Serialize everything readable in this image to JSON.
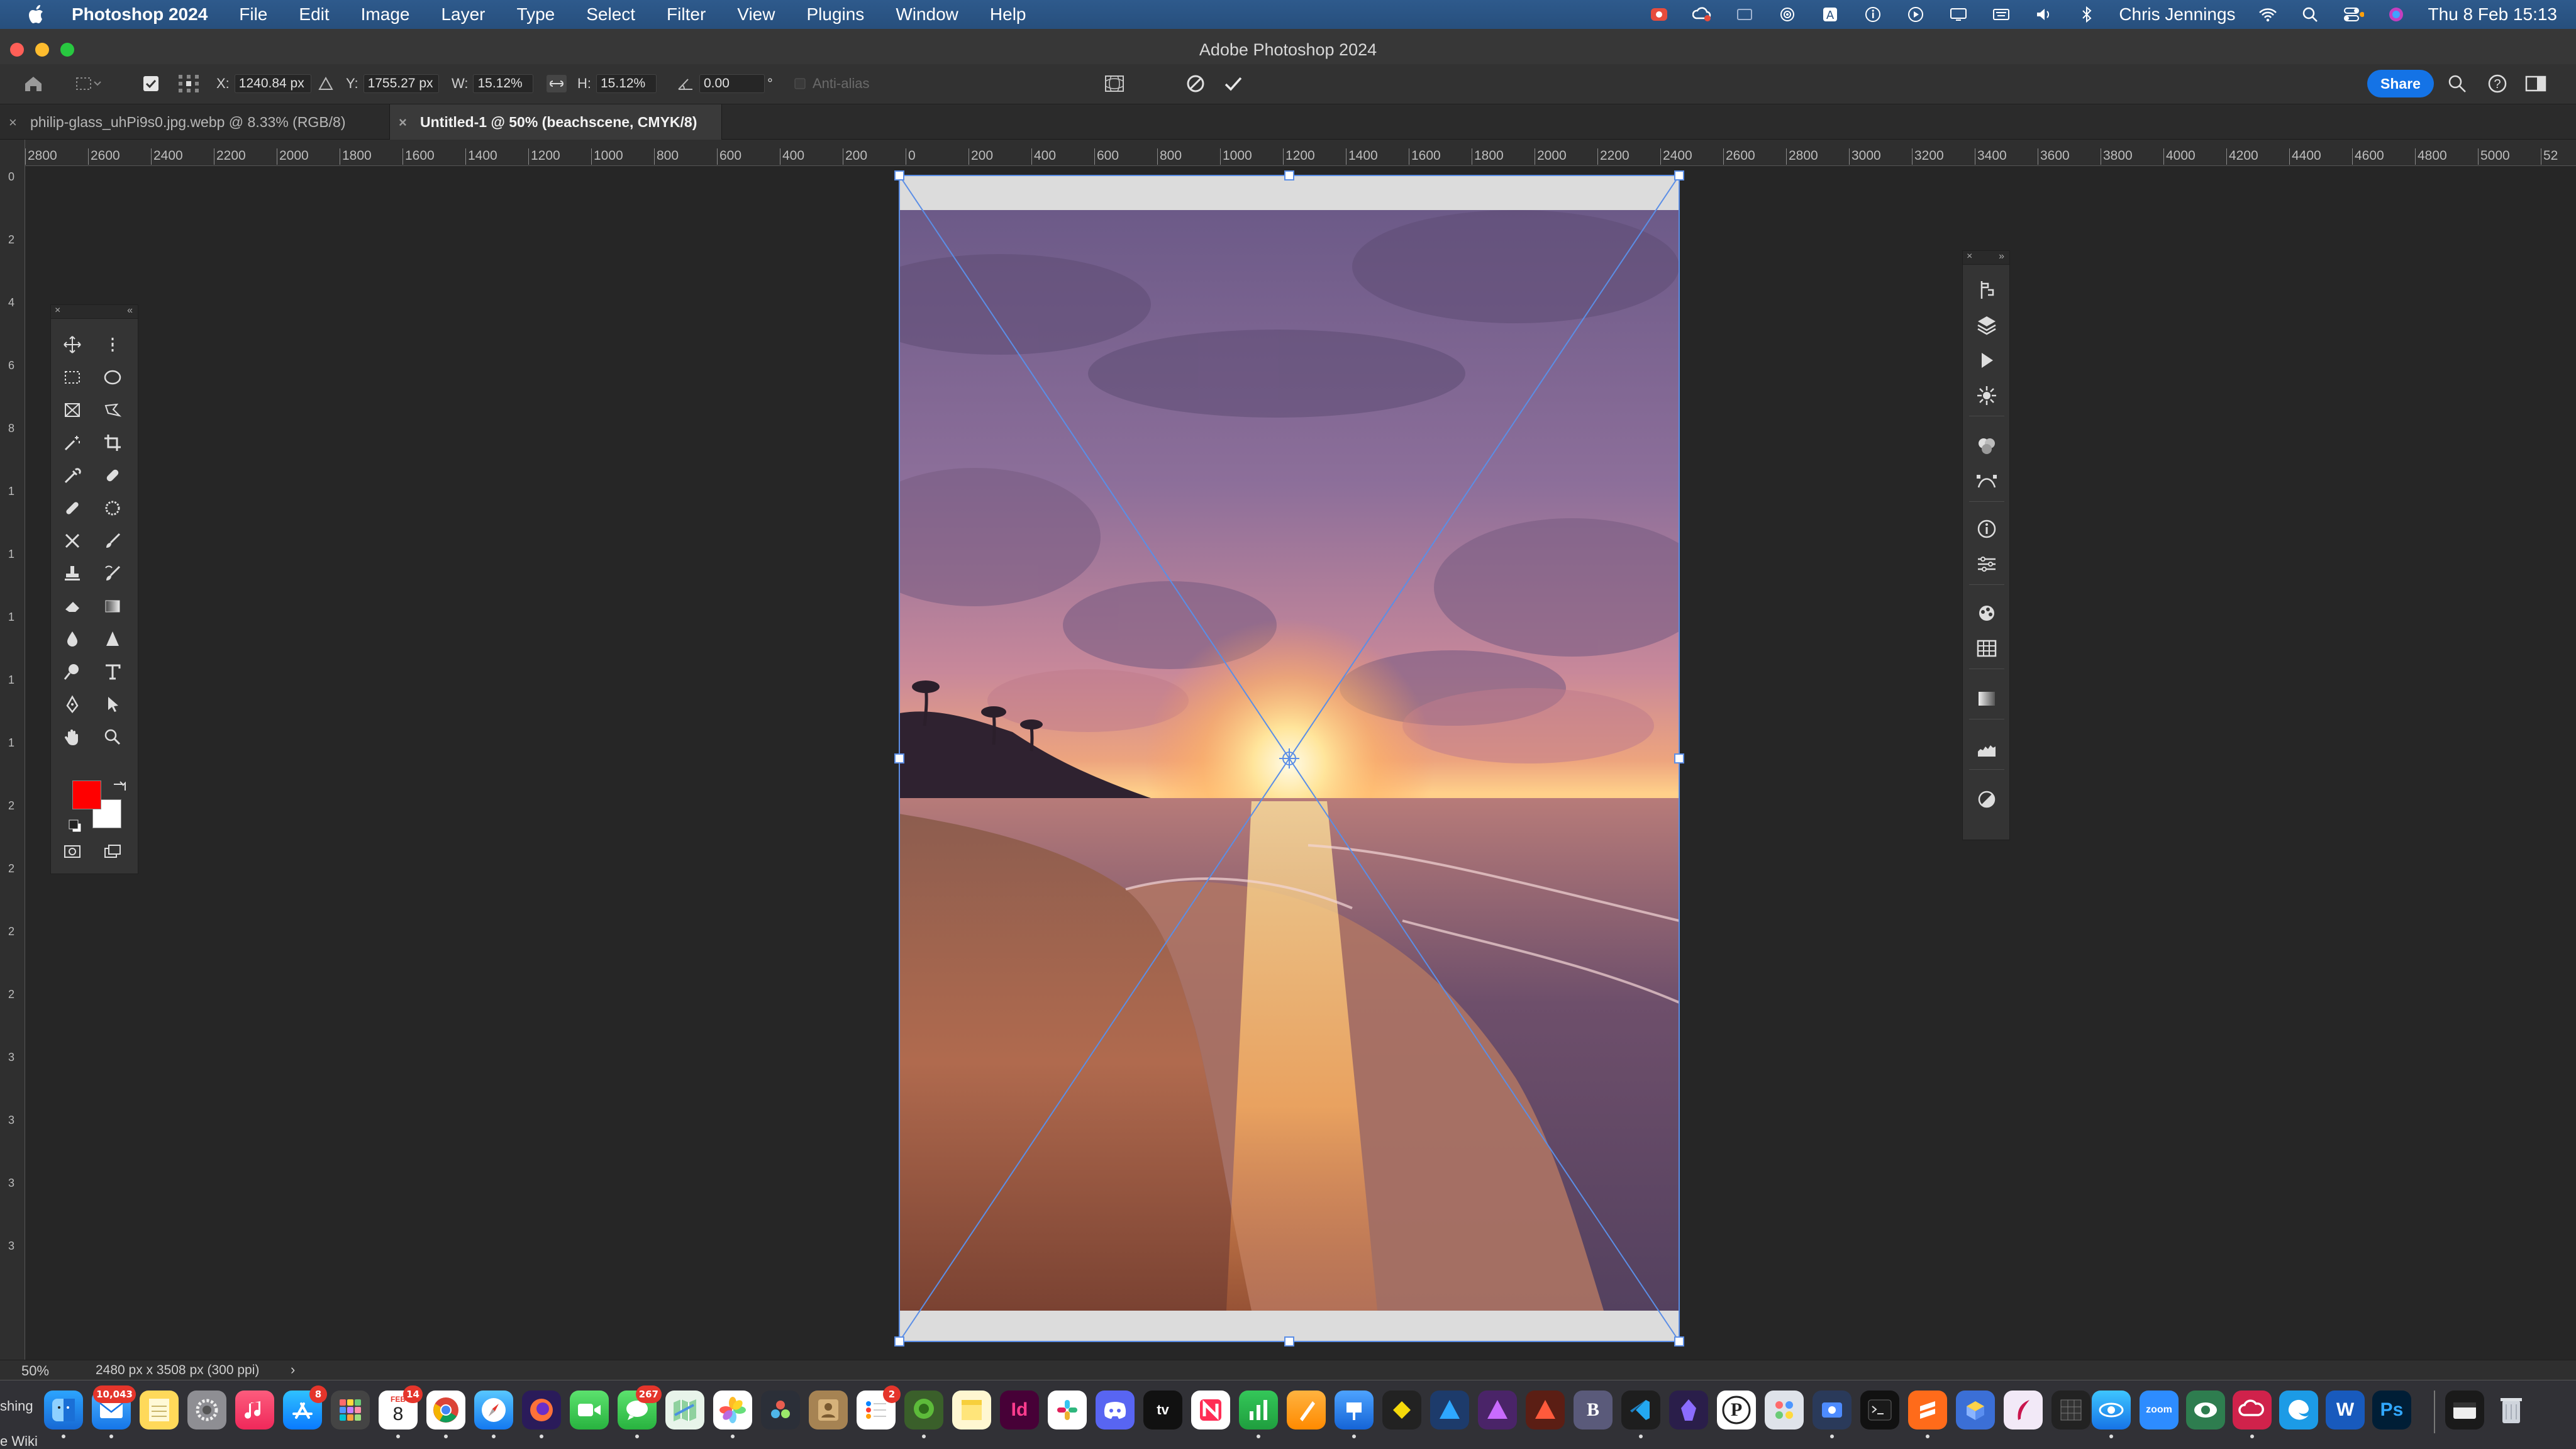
{
  "menubar": {
    "app_name": "Photoshop 2024",
    "menus": [
      "File",
      "Edit",
      "Image",
      "Layer",
      "Type",
      "Select",
      "Filter",
      "View",
      "Plugins",
      "Window",
      "Help"
    ],
    "user": "Chris Jennings",
    "clock": "Thu 8 Feb  15:13",
    "icons": [
      "creative-cloud-icon",
      "cc-sync-icon",
      "screen-record-icon",
      "airplay-icon",
      "a-status-icon",
      "info-status-icon",
      "play-status-icon",
      "display-icon",
      "keyboard-icon",
      "volume-icon",
      "bluetooth-icon",
      "wifi-icon",
      "spotlight-search-icon",
      "control-center-icon",
      "siri-icon"
    ]
  },
  "window": {
    "title": "Adobe Photoshop 2024"
  },
  "options": {
    "x_label": "X:",
    "x_value": "1240.84 px",
    "y_label": "Y:",
    "y_value": "1755.27 px",
    "w_label": "W:",
    "w_value": "15.12%",
    "h_label": "H:",
    "h_value": "15.12%",
    "angle_value": "0.00",
    "degree_symbol": "°",
    "antialias_label": "Anti-alias",
    "share_label": "Share"
  },
  "tabs": [
    {
      "label": "philip-glass_uhPi9s0.jpg.webp @ 8.33% (RGB/8)",
      "active": false
    },
    {
      "label": "Untitled-1 @ 50% (beachscene, CMYK/8)",
      "active": true
    }
  ],
  "ruler": {
    "h_ticks": [
      "2800",
      "2600",
      "2400",
      "2200",
      "2000",
      "1800",
      "1600",
      "1400",
      "1200",
      "1000",
      "800",
      "600",
      "400",
      "200",
      "0",
      "200",
      "400",
      "600",
      "800",
      "1000",
      "1200",
      "1400",
      "1600",
      "1800",
      "2000",
      "2200",
      "2400",
      "2600",
      "2800",
      "3000",
      "3200",
      "3400",
      "3600",
      "3800",
      "4000",
      "4200",
      "4400",
      "4600",
      "4800",
      "5000",
      "52"
    ],
    "v_ticks": [
      "0",
      "2",
      "4",
      "6",
      "8",
      "1",
      "1",
      "1",
      "1",
      "1",
      "2",
      "2",
      "2",
      "2",
      "3",
      "3",
      "3",
      "3"
    ]
  },
  "status": {
    "zoom": "50%",
    "doc_info": "2480 px x 3508 px (300 ppi)",
    "arrow": "›"
  },
  "colors": {
    "foreground": "#ff0000",
    "background": "#ffffff",
    "accent": "#1473e6",
    "transform_line": "#5b8ee6"
  },
  "dock": {
    "left_edge_text": "shing",
    "left_edge_text2": "e Wiki",
    "mail_badge": "10,043",
    "appstore_badge": "8",
    "messages_badge": "267",
    "reminders_badge": "2",
    "calendar_month": "FEB",
    "calendar_day": "8",
    "calendar_badge": "14",
    "indesign_label": "Id",
    "tv_label": "tv",
    "bbedit_label": "B",
    "p_label": "P",
    "zoom_label": "zoom",
    "word_label": "W",
    "ps_label": "Ps"
  }
}
